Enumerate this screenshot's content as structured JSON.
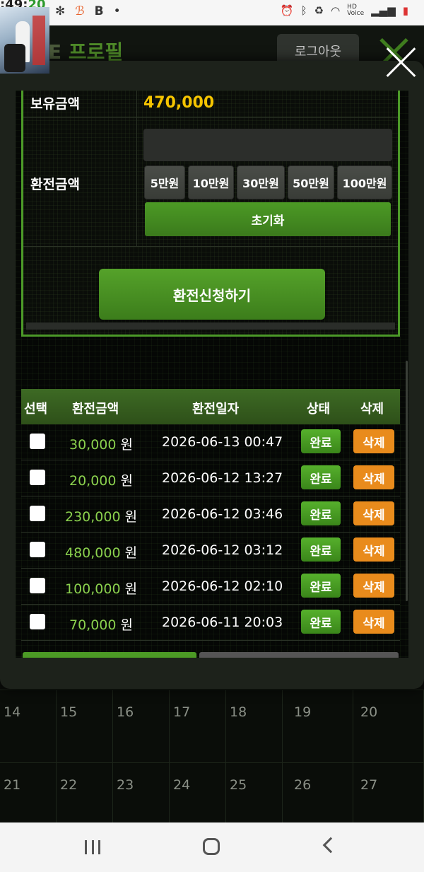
{
  "status_bar": {
    "clock_fragment": ":49:",
    "clock_fragment_green": "20",
    "icons_left": [
      "fan-icon",
      "bmoji-icon",
      "b-app-icon",
      "dot-icon"
    ],
    "icons_right": [
      "alarm-icon",
      "bluetooth-icon",
      "battery-saver-icon",
      "wifi-icon",
      "hd-voice-icon",
      "signal-icon",
      "battery-icon"
    ]
  },
  "background_page": {
    "title_prefix": "E",
    "title_main": "프로필",
    "logout_label": "로그아웃",
    "calendar_rows": [
      [
        "14",
        "15",
        "16",
        "17",
        "18",
        "19",
        "20"
      ],
      [
        "21",
        "22",
        "23",
        "24",
        "25",
        "26",
        "27"
      ]
    ]
  },
  "form": {
    "balance_label": "보유금액",
    "balance_value": "470,000",
    "exchange_label": "환전금액",
    "amount_input_value": "",
    "amount_buttons": [
      "5만원",
      "10만원",
      "30만원",
      "50만원",
      "100만원"
    ],
    "reset_label": "초기화",
    "apply_label": "환전신청하기"
  },
  "history": {
    "columns": [
      "선택",
      "환전금액",
      "환전일자",
      "상태",
      "삭제"
    ],
    "currency_unit": "원",
    "rows": [
      {
        "amount": "30,000",
        "date": "2026-06-13 00:47",
        "status": "완료",
        "delete": "삭제"
      },
      {
        "amount": "20,000",
        "date": "2026-06-12 13:27",
        "status": "완료",
        "delete": "삭제"
      },
      {
        "amount": "230,000",
        "date": "2026-06-12 03:46",
        "status": "완료",
        "delete": "삭제"
      },
      {
        "amount": "480,000",
        "date": "2026-06-12 03:12",
        "status": "완료",
        "delete": "삭제"
      },
      {
        "amount": "100,000",
        "date": "2026-06-12 02:10",
        "status": "완료",
        "delete": "삭제"
      },
      {
        "amount": "70,000",
        "date": "2026-06-11 20:03",
        "status": "완료",
        "delete": "삭제"
      }
    ]
  },
  "colors": {
    "accent_green": "#4c9a28",
    "balance_yellow": "#f5c400",
    "amount_green": "#8bd14e",
    "delete_orange": "#e98b1c"
  }
}
